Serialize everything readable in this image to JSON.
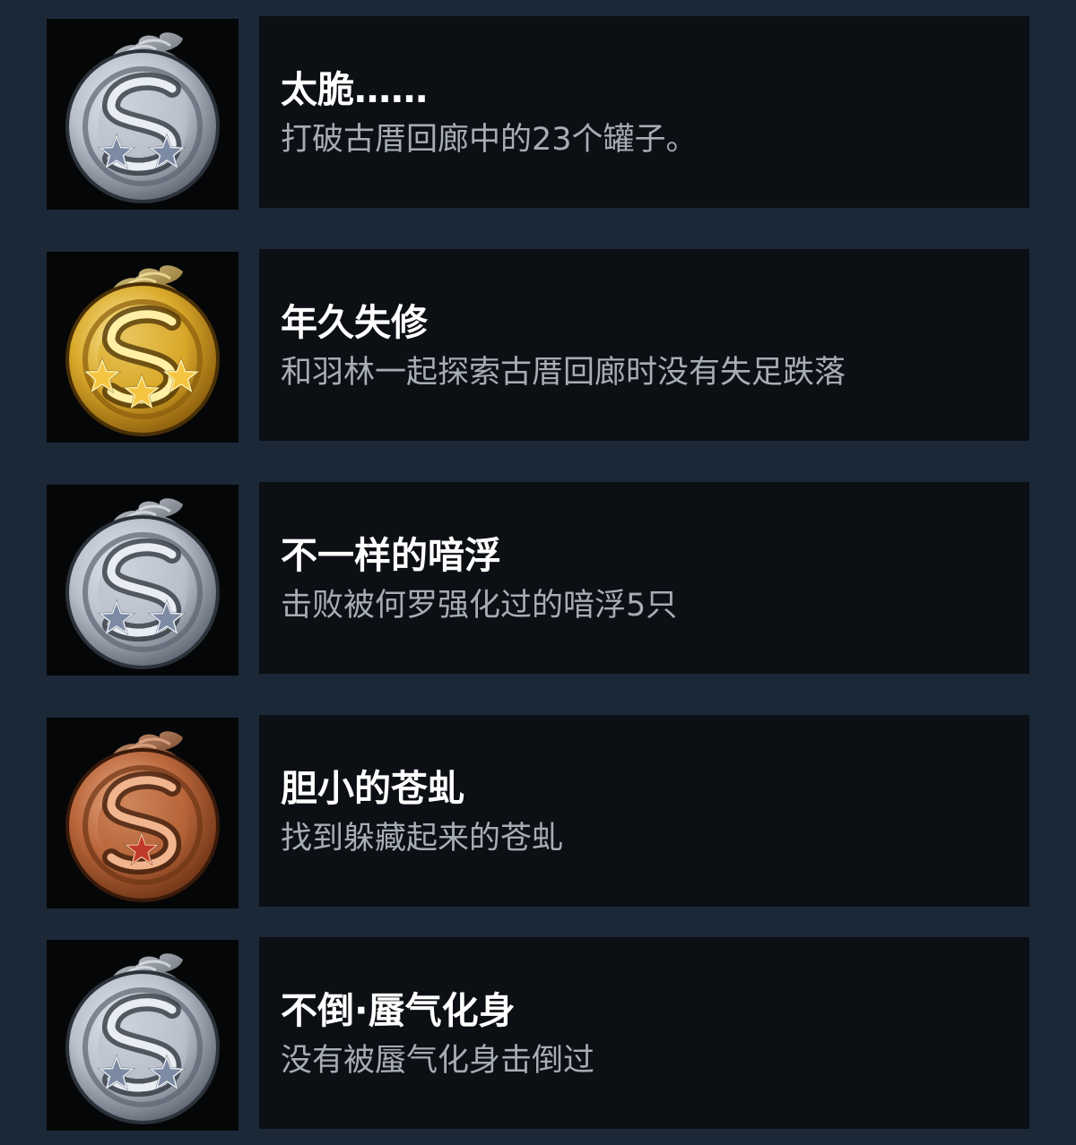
{
  "achievements": [
    {
      "title": "太脆……",
      "description": "打破古厝回廊中的23个罐子。",
      "tier": "silver",
      "stars": 2,
      "icon": "silver-dragon-medal-icon"
    },
    {
      "title": "年久失修",
      "description": "和羽林一起探索古厝回廊时没有失足跌落",
      "tier": "gold",
      "stars": 3,
      "icon": "gold-dragon-medal-icon"
    },
    {
      "title": "不一样的喑浮",
      "description": "击败被何罗强化过的喑浮5只",
      "tier": "silver",
      "stars": 2,
      "icon": "silver-dragon-medal-icon"
    },
    {
      "title": "胆小的苍虬",
      "description": "找到躲藏起来的苍虬",
      "tier": "bronze",
      "stars": 1,
      "icon": "bronze-dragon-medal-icon"
    },
    {
      "title": "不倒·蜃气化身",
      "description": "没有被蜃气化身击倒过",
      "tier": "silver",
      "stars": 2,
      "icon": "silver-dragon-medal-icon"
    }
  ],
  "colors": {
    "page_background": "#1b2838",
    "panel_background": "#0c0f14",
    "title_text": "#ffffff",
    "description_text": "#a6adb5",
    "silver": "#b9c0cc",
    "gold": "#d9a82a",
    "bronze": "#b8653a"
  }
}
